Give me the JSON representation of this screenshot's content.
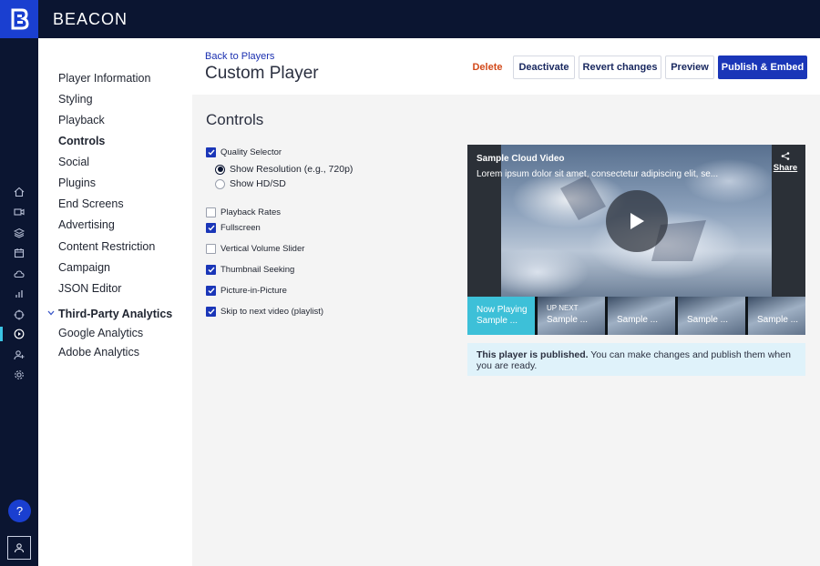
{
  "app": {
    "brand": "BEACON"
  },
  "colors": {
    "brand": "#1a3fd0",
    "topbar": "#0b1531",
    "accent": "#3bc4e5",
    "danger": "#d24a1b",
    "notice_bg": "#dff2fa"
  },
  "rail": {
    "icons": [
      "home-icon",
      "video-camera-icon",
      "layers-icon",
      "calendar-icon",
      "cloud-icon",
      "bar-chart-icon",
      "target-icon",
      "play-circle-icon",
      "user-add-icon",
      "gear-icon"
    ],
    "help_label": "?"
  },
  "subnav": {
    "items": [
      {
        "label": "Player Information"
      },
      {
        "label": "Styling"
      },
      {
        "label": "Playback"
      },
      {
        "label": "Controls"
      },
      {
        "label": "Social"
      },
      {
        "label": "Plugins"
      },
      {
        "label": "End Screens"
      },
      {
        "label": "Advertising"
      },
      {
        "label": "Content Restriction"
      },
      {
        "label": "Campaign"
      },
      {
        "label": "JSON Editor"
      }
    ],
    "group": {
      "label": "Third-Party Analytics",
      "items": [
        {
          "label": "Google Analytics"
        },
        {
          "label": "Adobe Analytics"
        }
      ]
    }
  },
  "header": {
    "back_link": "Back to Players",
    "title": "Custom Player",
    "buttons": {
      "delete": "Delete",
      "deactivate": "Deactivate",
      "revert": "Revert changes",
      "preview": "Preview",
      "publish": "Publish & Embed"
    }
  },
  "controls": {
    "title": "Controls",
    "quality_selector": {
      "label": "Quality Selector",
      "checked": true
    },
    "radios": [
      {
        "label": "Show Resolution (e.g., 720p)",
        "selected": true
      },
      {
        "label": "Show HD/SD",
        "selected": false
      }
    ],
    "options": [
      {
        "label": "Playback Rates",
        "checked": false
      },
      {
        "label": "Fullscreen",
        "checked": true
      },
      {
        "label": "Vertical Volume Slider",
        "checked": false
      },
      {
        "label": "Thumbnail Seeking",
        "checked": true
      },
      {
        "label": "Picture-in-Picture",
        "checked": true
      },
      {
        "label": "Skip to next video (playlist)",
        "checked": true
      }
    ]
  },
  "player": {
    "title": "Sample Cloud Video",
    "description": "Lorem ipsum dolor sit amet, consectetur adipiscing elit, se...",
    "share": "Share",
    "playlist": [
      {
        "label": "Now Playing",
        "title": "Sample ..."
      },
      {
        "label": "UP NEXT",
        "title": "Sample ..."
      },
      {
        "label": "",
        "title": "Sample ..."
      },
      {
        "label": "",
        "title": "Sample ..."
      },
      {
        "label": "",
        "title": "Sample ..."
      }
    ]
  },
  "notice": {
    "bold": "This player is published.",
    "text": " You can make changes and publish them when you are ready."
  }
}
